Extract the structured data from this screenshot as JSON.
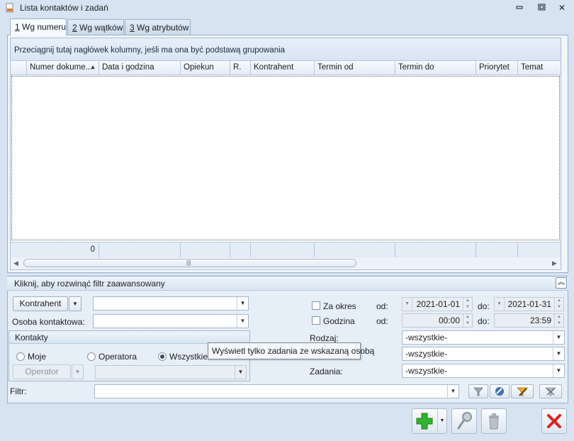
{
  "window": {
    "title": "Lista kontaktów i zadań",
    "minimize_glyph": "▭",
    "maximize_glyph": "▣",
    "close_glyph": "✕"
  },
  "tabs": [
    {
      "key": "1",
      "label": " Wg numeru"
    },
    {
      "key": "2",
      "label": " Wg wątków"
    },
    {
      "key": "3",
      "label": " Wg atrybutów"
    }
  ],
  "grid": {
    "group_hint": "Przeciągnij tutaj nagłówek kolumny, jeśli ma ona być podstawą grupowania",
    "columns": [
      "Numer dokume...",
      "Data i godzina",
      "Opiekun",
      "R.",
      "Kontrahent",
      "Termin od",
      "Termin do",
      "Priorytet",
      "Temat"
    ],
    "sort_indicator": "▲",
    "footer_count": "0",
    "scroll_grip": "|||",
    "scroll_left": "◀",
    "scroll_right": "▶"
  },
  "filter": {
    "header": "Kliknij, aby rozwinąć filtr zaawansowany",
    "collapse_glyph": "︽",
    "kontrahent_button": "Kontrahent",
    "kontrahent_value": "",
    "osoba_label": "Osoba kontaktowa:",
    "osoba_value": "",
    "kontakty": {
      "title": "Kontakty",
      "options": [
        "Moje",
        "Operatora",
        "Wszystkie"
      ],
      "selected": "Wszystkie",
      "operator_button": "Operator",
      "operator_value": ""
    },
    "tooltip": "Wyświetl tylko zadania ze wskazaną osobą",
    "za_okres": {
      "label": "Za okres",
      "od_label": "od:",
      "od_value": "2021-01-01",
      "do_label": "do:",
      "do_value": "2021-01-31"
    },
    "godzina": {
      "label": "Godzina",
      "od_label": "od:",
      "od_value": "00:00",
      "do_label": "do:",
      "do_value": "23:59"
    },
    "rodzaj": {
      "label": "Rodzaj:",
      "value": "-wszystkie-"
    },
    "second_value": "-wszystkie-",
    "zadania": {
      "label": "Zadania:",
      "value": "-wszystkie-"
    },
    "filtr_label": "Filtr:",
    "filtr_value": ""
  },
  "colors": {
    "add_green": "#2fb52a",
    "close_red": "#e0201a",
    "accent_blue": "#3d6fb8"
  }
}
